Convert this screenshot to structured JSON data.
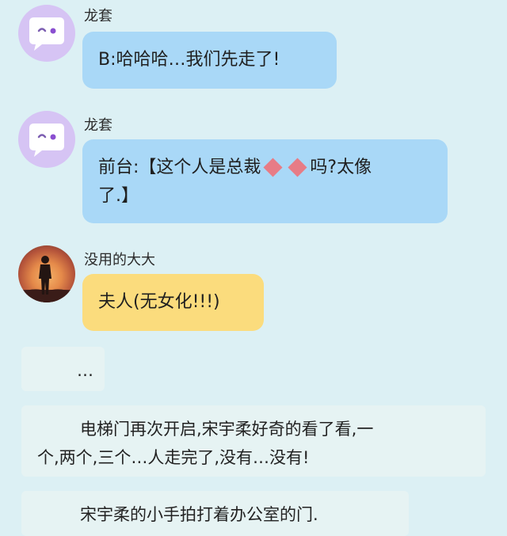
{
  "messages": [
    {
      "sender": "龙套",
      "text": "B:哈哈哈…我们先走了!"
    },
    {
      "sender": "龙套",
      "text_before": "前台:【这个人是总裁",
      "text_after": "吗?太像",
      "text_line2": "了.】"
    },
    {
      "sender": "没用的大大",
      "text": "夫人(无女化!!!)"
    }
  ],
  "narration": [
    {
      "text": "…"
    },
    {
      "line1": "电梯门再次开启,宋宇柔好奇的看了看,一",
      "line2": "个,两个,三个…人走完了,没有…没有!"
    },
    {
      "text": "宋宇柔的小手拍打着办公室的门."
    }
  ],
  "colors": {
    "background": "#dcf0f4",
    "bubble_blue": "#a9d8f7",
    "bubble_yellow": "#fbdc7d",
    "narration_box": "#e6f3f3",
    "avatar_purple": "#d6c4f4",
    "diamond": "#e77c86"
  },
  "icons": {
    "wink_avatar": "speech-bubble-wink-icon",
    "photo_avatar": "person-sunset-photo",
    "decorative_emoji": "red-diamond-emoji"
  }
}
